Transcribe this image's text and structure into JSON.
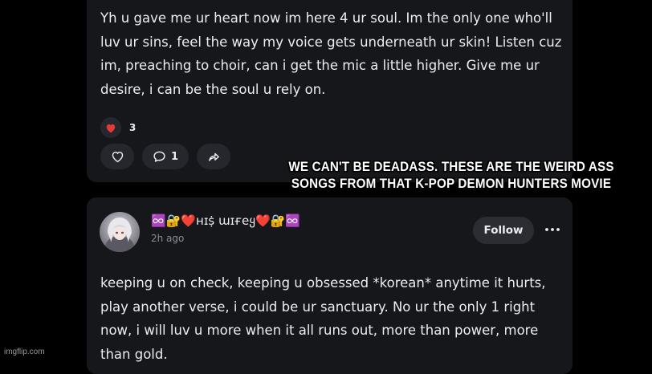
{
  "comment1": {
    "text": "Yh u gave me ur heart now im here 4 ur soul. Im the only one who'll luv ur sins, feel the way my voice gets underneath ur skin! Listen cuz im, preaching to choir, can i get the mic a little higher. Give me ur desire, i can be the soul u rely on.",
    "reaction_icon": "heart-icon",
    "reaction_count": "3",
    "reply_count": "1"
  },
  "comment2": {
    "username": "♾️🔐❤️ʜɪṩ ɯɪғeყ❤️🔐♾️",
    "timestamp": "2h ago",
    "follow_label": "Follow",
    "text": "keeping u on check, keeping u obsessed *korean* anytime it hurts, play another verse, i could be ur sanctuary. No ur the only 1 right now, i will luv u more when it all runs out, more than power, more than gold."
  },
  "caption": "WE CAN'T BE DEADASS. THESE ARE THE WEIRD ASS SONGS FROM THAT K-POP DEMON HUNTERS MOVIE",
  "watermark": "imgflip.com",
  "colors": {
    "background": "#000000",
    "card": "#16171b",
    "pill": "#26272d",
    "heart": "#e53935"
  }
}
